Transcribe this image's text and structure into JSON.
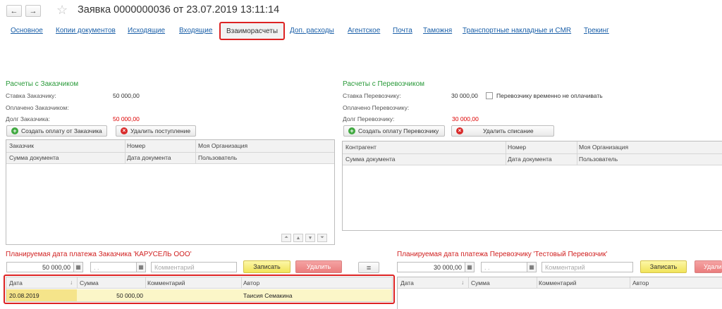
{
  "header": {
    "back": "←",
    "forward": "→",
    "star": "☆",
    "title": "Заявка 0000000036 от 23.07.2019 13:11:14"
  },
  "tabs": [
    "Основное",
    "Копии документов",
    "Исходящие",
    "Входящие",
    "Взаиморасчеты",
    "Доп. расходы",
    "Агентское",
    "Почта",
    "Таможня",
    "Транспортные накладные и CMR",
    "Трекинг"
  ],
  "customer": {
    "title": "Расчеты с Заказчиком",
    "rate_label": "Ставка Заказчику:",
    "rate_value": "50 000,00",
    "paid_label": "Оплачено Заказчиком:",
    "debt_label": "Долг Заказчика:",
    "debt_value": "50 000,00",
    "create_btn": "Создать оплату от Заказчика",
    "delete_btn": "Удалить поступление",
    "grid_headers": [
      "Заказчик",
      "Номер",
      "Моя Организация",
      "Сумма документа",
      "Дата документа",
      "Пользователь"
    ]
  },
  "carrier": {
    "title": "Расчеты с Перевозчиком",
    "rate_label": "Ставка Перевозчику:",
    "rate_value": "30 000,00",
    "nopay_label": "Перевозчику временно не оплачивать",
    "paid_label": "Оплачено Перевозчику:",
    "debt_label": "Долг Перевозчику:",
    "debt_value": "30 000,00",
    "create_btn": "Создать оплату Перевозчику",
    "delete_btn": "Удалить списание",
    "grid_headers": [
      "Контрагент",
      "Номер",
      "Моя Организация",
      "Сумма документа",
      "Дата документа",
      "Пользователь"
    ]
  },
  "plan_customer": {
    "title": "Планируемая дата платежа Заказчика 'КАРУСЕЛЬ ООО'",
    "amount": "50 000,00",
    "date_placeholder": ". .",
    "comment_placeholder": "Комментарий",
    "save_btn": "Записать",
    "delete_btn": "Удалить",
    "columns": [
      "Дата",
      "Сумма",
      "Комментарий",
      "Автор"
    ],
    "rows": [
      {
        "date": "20.08.2019",
        "amount": "50 000,00",
        "comment": "",
        "author": "Таисия Семакина"
      }
    ]
  },
  "plan_carrier": {
    "title": "Планируемая дата платежа Перевозчику 'Тестовый Перевозчик'",
    "amount": "30 000,00",
    "date_placeholder": ". .",
    "comment_placeholder": "Комментарий",
    "save_btn": "Записать",
    "delete_btn": "Удали",
    "columns": [
      "Дата",
      "Сумма",
      "Комментарий",
      "Автор"
    ]
  },
  "colors": {
    "link": "#1a5fa8",
    "section_green": "#2a9a3a",
    "debt_red": "#dd0000",
    "highlight_frame": "#dd2222",
    "selected_row": "#fbf6c8"
  }
}
